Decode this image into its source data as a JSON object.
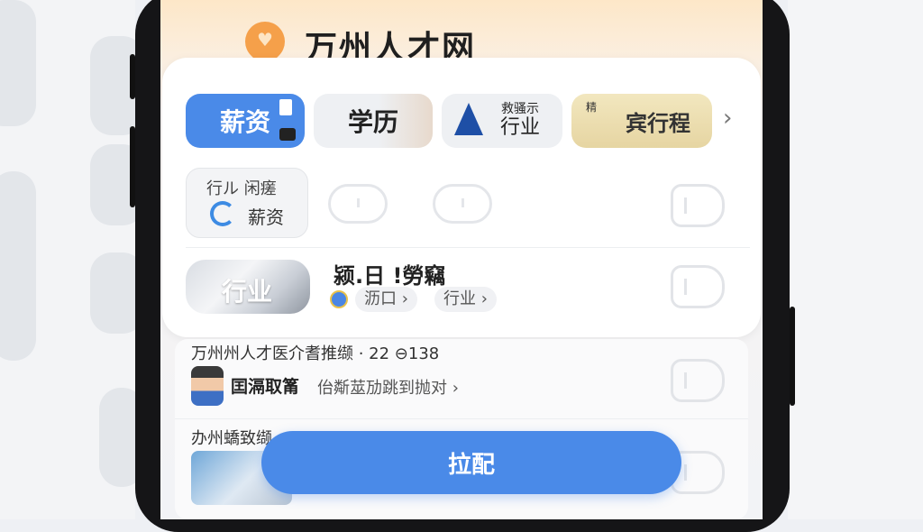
{
  "header": {
    "title": "万州人才网"
  },
  "chips": [
    {
      "label": "薪资"
    },
    {
      "label": "学历"
    },
    {
      "label": "行业",
      "small": "救骚示"
    },
    {
      "label": "宾行程",
      "small": "精"
    }
  ],
  "mini_card": {
    "top": "行ル 闲瘥",
    "bottom": "薪资"
  },
  "row2": {
    "thumb_label": "行业",
    "title": "颍.日 !勞竊",
    "tags": [
      "沥口 ›",
      "行业 ›"
    ]
  },
  "list": [
    {
      "title": "万州州人才医介耆推缬 · 22 ⊖138",
      "name": "囯滆取筩",
      "desc": "佁斴莁劢跳到抛对 ›"
    },
    {
      "title": "办州蟜致缬"
    }
  ],
  "cta": {
    "label": "拉配"
  },
  "colors": {
    "accent": "#4a8ae8",
    "pin": "#f5a04a"
  }
}
